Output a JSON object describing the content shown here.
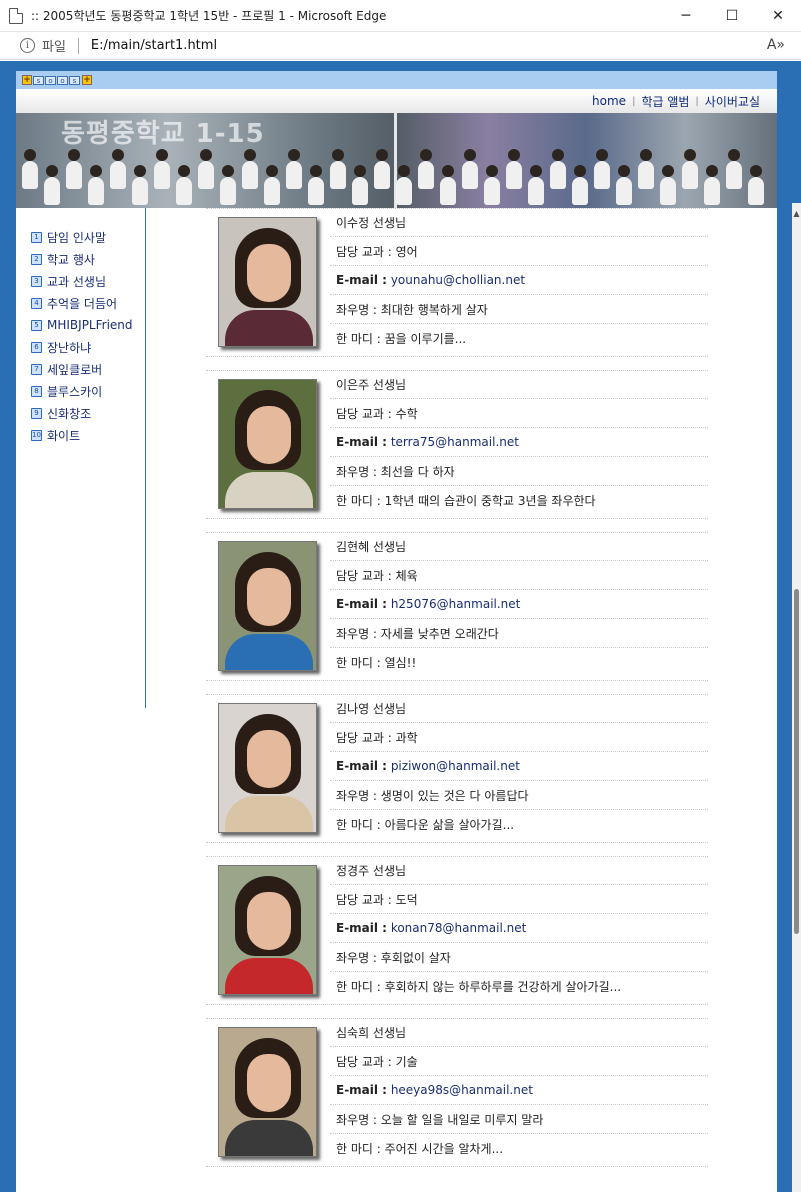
{
  "window": {
    "title": ":: 2005학년도 동평중학교 1학년 15반 - 프로필 1 - Microsoft Edge",
    "controls": {
      "minimize": "─",
      "maximize": "☐",
      "close": "✕"
    }
  },
  "addressbar": {
    "scheme_label": "파일",
    "url": "E:/main/start1.html",
    "read_aloud": "A»"
  },
  "topstrip": {
    "icons": [
      "plus-icon",
      "tag-icon",
      "tag-icon",
      "tag-icon",
      "tag-icon",
      "plus-icon"
    ]
  },
  "nav": {
    "items": [
      {
        "label": "home"
      },
      {
        "label": "학급 앨범"
      },
      {
        "label": "사이버교실"
      }
    ]
  },
  "banner": {
    "title": "동평중학교 1-15"
  },
  "sidebar": {
    "items": [
      {
        "num": "1",
        "label": "담임 인사말"
      },
      {
        "num": "2",
        "label": "학교 행사"
      },
      {
        "num": "3",
        "label": "교과 선생님"
      },
      {
        "num": "4",
        "label": "추억을 더듬어"
      },
      {
        "num": "5",
        "label": "MHIBJPLFriend"
      },
      {
        "num": "6",
        "label": "장난하냐"
      },
      {
        "num": "7",
        "label": "세잎클로버"
      },
      {
        "num": "8",
        "label": "블루스카이"
      },
      {
        "num": "9",
        "label": "신화창조"
      },
      {
        "num": "10",
        "label": "화이트"
      }
    ]
  },
  "teachers": [
    {
      "name": "이수정 선생님",
      "subject": "담당 교과 : 영어",
      "email_label": "E-mail :",
      "email": "younahu@chollian.net",
      "motto": "좌우명 : 최대한 행복하게 살자",
      "comment": "한 마디 : 꿈을 이루기를...",
      "photo_bg": "#c9c3bd",
      "body_color": "#5a2a36"
    },
    {
      "name": "이은주 선생님",
      "subject": "담당 교과 : 수학",
      "email_label": "E-mail :",
      "email": "terra75@hanmail.net",
      "motto": "좌우명 : 최선을 다 하자",
      "comment": "한 마디 : 1학년 때의 습관이 중학교 3년을 좌우한다",
      "photo_bg": "#5d6f3f",
      "body_color": "#d8d2c2"
    },
    {
      "name": "김현혜 선생님",
      "subject": "담당 교과 : 체육",
      "email_label": "E-mail :",
      "email": "h25076@hanmail.net",
      "motto": "좌우명 : 자세를 낮추면 오래간다",
      "comment": "한 마디 : 열심!!",
      "photo_bg": "#8a9474",
      "body_color": "#2a6fb4"
    },
    {
      "name": "김나영 선생님",
      "subject": "담당 교과 : 과학",
      "email_label": "E-mail :",
      "email": "piziwon@hanmail.net",
      "motto": "좌우명 : 생명이 있는 것은 다 아름답다",
      "comment": "한 마디 : 아름다운 삶을 살아가길...",
      "photo_bg": "#d9d4cf",
      "body_color": "#d9c4a6"
    },
    {
      "name": "정경주 선생님",
      "subject": "담당 교과 : 도덕",
      "email_label": "E-mail :",
      "email": "konan78@hanmail.net",
      "motto": "좌우명 : 후회없이 살자",
      "comment": "한 마디 : 후회하지 않는 하루하루를 건강하게 살아가길...",
      "photo_bg": "#9aa58a",
      "body_color": "#c4282a"
    },
    {
      "name": "심숙희 선생님",
      "subject": "담당 교과 : 기술",
      "email_label": "E-mail :",
      "email": "heeya98s@hanmail.net",
      "motto": "좌우명 : 오늘 할 일을 내일로 미루지 말라",
      "comment": "한 마디 : 주어진 시간을 알차게...",
      "photo_bg": "#b9a98e",
      "body_color": "#3a3a3a"
    }
  ]
}
